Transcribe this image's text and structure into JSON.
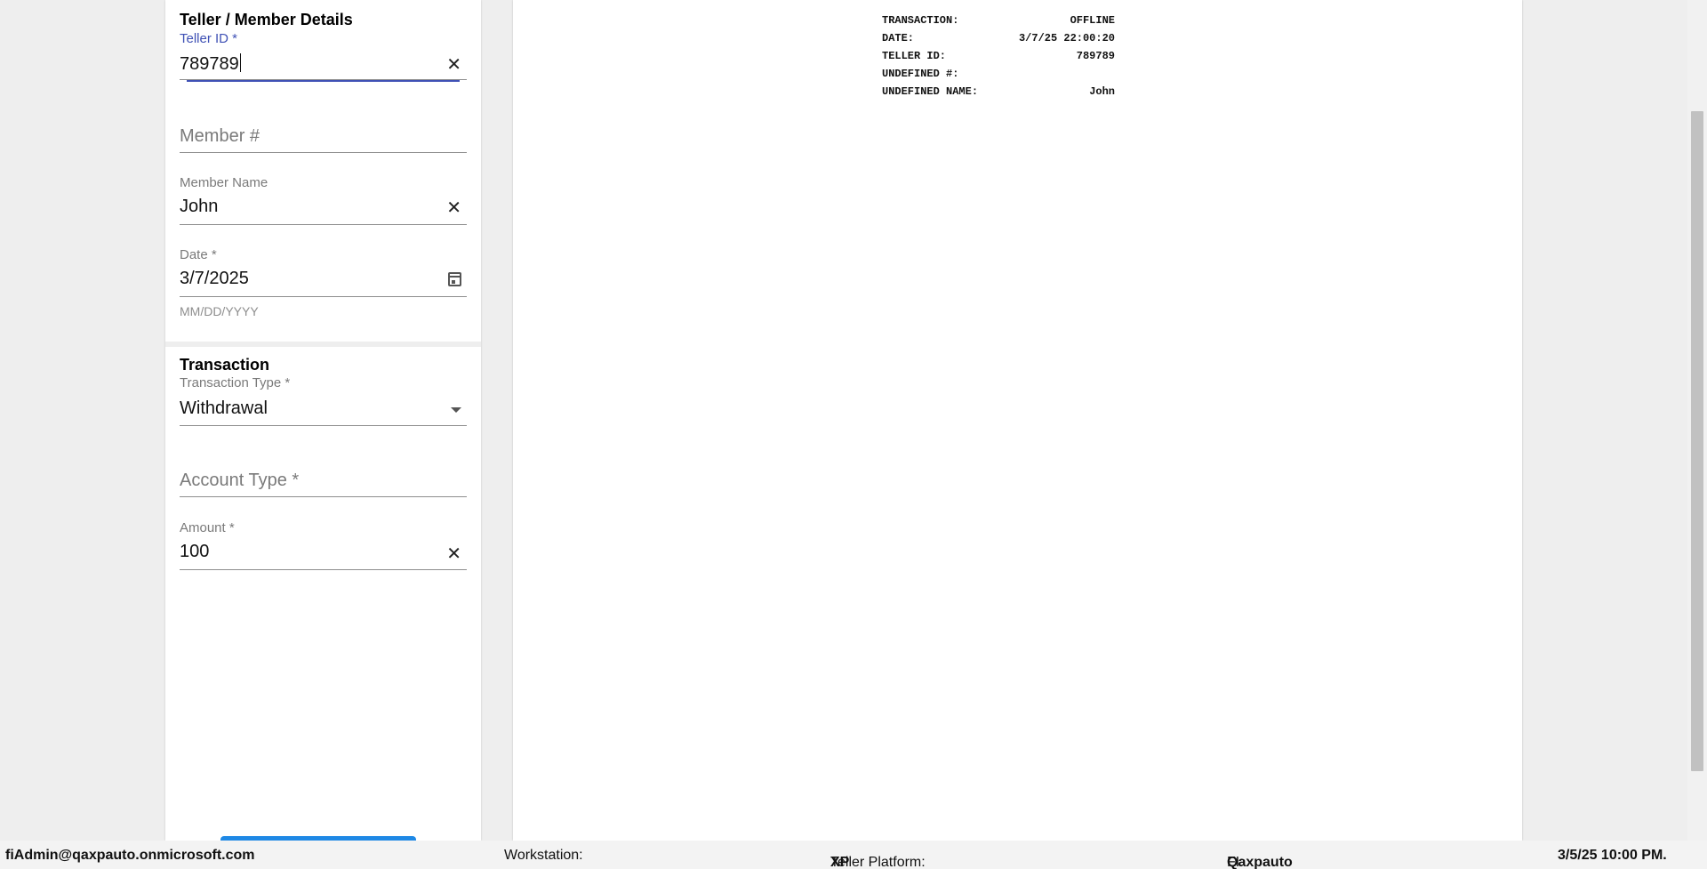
{
  "teller_member": {
    "title": "Teller / Member Details",
    "teller_id": {
      "label": "Teller ID *",
      "value": "789789"
    },
    "member_number": {
      "placeholder": "Member #"
    },
    "member_name": {
      "label": "Member Name",
      "value": "John"
    },
    "date": {
      "label": "Date *",
      "value": "3/7/2025",
      "helper": "MM/DD/YYYY"
    }
  },
  "transaction": {
    "title": "Transaction",
    "transaction_type": {
      "label": "Transaction Type *",
      "value": "Withdrawal"
    },
    "account_type": {
      "placeholder": "Account Type *"
    },
    "amount": {
      "label": "Amount *",
      "value": "100"
    }
  },
  "receipt": {
    "rows": [
      {
        "key": "TRANSACTION:",
        "value": "OFFLINE"
      },
      {
        "key": "DATE:",
        "value": "3/7/25 22:00:20"
      },
      {
        "key": "TELLER ID:",
        "value": "789789"
      },
      {
        "key": "UNDEFINED #:",
        "value": ""
      },
      {
        "key": "UNDEFINED NAME:",
        "value": "John"
      }
    ]
  },
  "statusbar": {
    "user": "fiAdmin@qaxpauto.onmicrosoft.com",
    "workstation_label": "Workstation:",
    "platform_label": "Teller Platform:",
    "platform_value": "XP",
    "fi_label": "FI:",
    "fi_value": "Qaxpauto",
    "datetime": "3/5/25 10:00 PM."
  },
  "colors": {
    "focus": "#3f51b5",
    "button": "#1e88e5"
  }
}
